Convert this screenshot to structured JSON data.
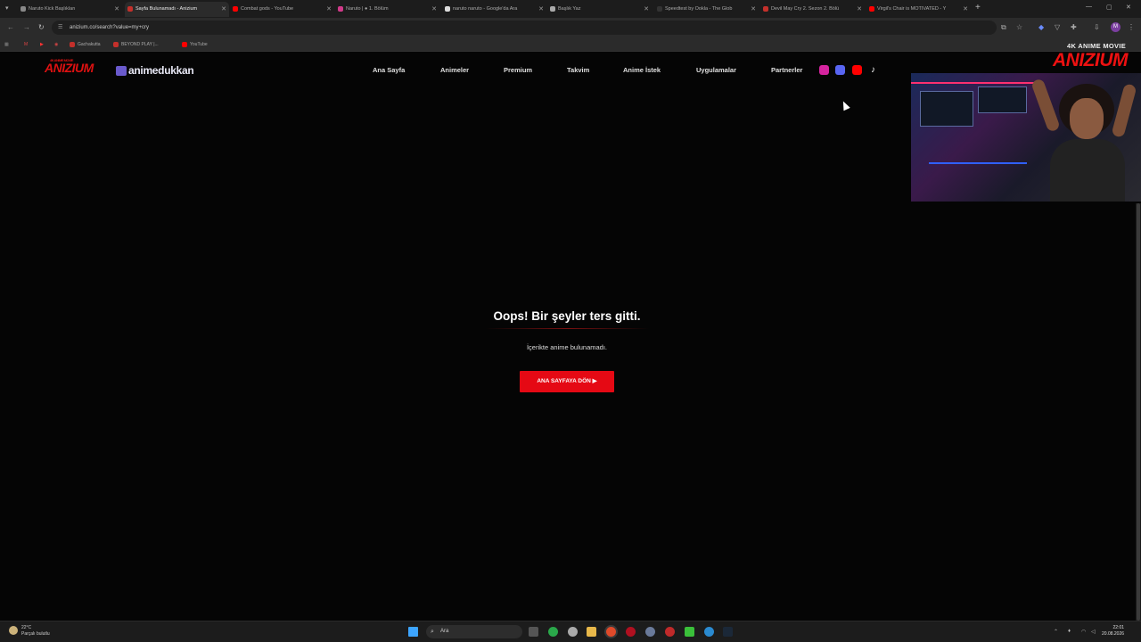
{
  "browser": {
    "tabs": [
      {
        "title": "Naruto Kick Başlıkları",
        "fav": "#888888",
        "active": false
      },
      {
        "title": "Sayfa Bulunamadı - Anizium",
        "fav": "#c4302b",
        "active": true
      },
      {
        "title": "Combat gods - YouTube",
        "fav": "#ff0000",
        "active": false
      },
      {
        "title": "Naruto | ● 1. Bölüm",
        "fav": "#d13a8a",
        "active": false
      },
      {
        "title": "naruto naruto - Google'da Ara",
        "fav": "#dddddd",
        "active": false
      },
      {
        "title": "Başlık Yaz",
        "fav": "#aaaaaa",
        "active": false
      },
      {
        "title": "Speedtest by Ookla - The Glob",
        "fav": "#333333",
        "active": false
      },
      {
        "title": "Devil May Cry 2. Sezon 2. Bölü",
        "fav": "#c4302b",
        "active": false
      },
      {
        "title": "Virgil's Chair is MOTIVATED - Y",
        "fav": "#ff0000",
        "active": false
      }
    ],
    "url": "anizium.co/search?value=my+cry",
    "bookmarks": [
      "Gachakutta",
      "BEYOND PLAY |...",
      "YouTube"
    ],
    "profile_initial": "M"
  },
  "site": {
    "logo1_tag": "4K ANIME MOVIE",
    "logo1": "ANIZIUM",
    "logo2": "animedukkan",
    "nav": [
      "Ana Sayfa",
      "Animeler",
      "Premium",
      "Takvim",
      "Anime İstek",
      "Uygulamalar",
      "Partnerler"
    ],
    "social": [
      {
        "name": "instagram-icon",
        "color": "#d6249f"
      },
      {
        "name": "discord-icon",
        "color": "#5865f2"
      },
      {
        "name": "youtube-icon",
        "color": "#ff0000"
      },
      {
        "name": "tiktok-icon",
        "color": "#000000"
      }
    ],
    "error_title": "Oops! Bir şeyler ters gitti.",
    "error_text": "İçerikte anime bulunamadı.",
    "error_button": "ANA SAYFAYA DÖN  ▶"
  },
  "overlay": {
    "brand_small": "4K ANIME MOVIE",
    "brand_big": "ANIZIUM"
  },
  "taskbar": {
    "temp": "22°C",
    "weather": "Parçalı bulutlu",
    "search_placeholder": "Ara",
    "time": "22:01",
    "date": "20.08.2026"
  }
}
